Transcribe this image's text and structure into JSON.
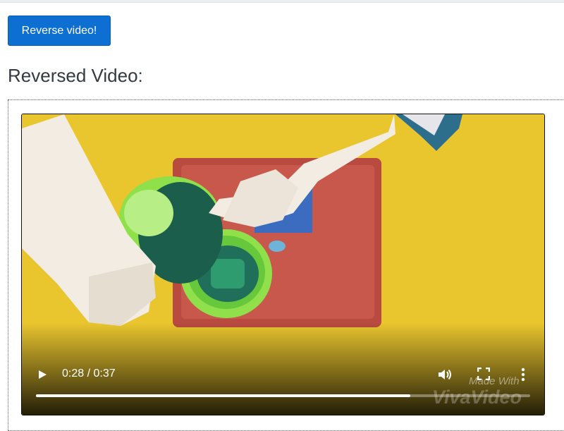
{
  "page": {
    "reverse_button_label": "Reverse video!",
    "section_title": "Reversed Video:"
  },
  "video": {
    "current_time": "0:28",
    "duration": "0:37",
    "time_text": "0:28 / 0:37",
    "progress_fraction": 0.7568,
    "watermark_line1": "Made With",
    "watermark_line2": "VivaVideo"
  },
  "icons": {
    "play": "play-icon",
    "volume": "volume-icon",
    "fullscreen": "fullscreen-icon",
    "more": "more-options-icon"
  },
  "colors": {
    "button_blue": "#0d6fd2",
    "table_yellow": "#e9c52e",
    "tray_red": "#c8584b",
    "bowl_green": "#8fe04a",
    "water_teal": "#1f6f5a"
  }
}
